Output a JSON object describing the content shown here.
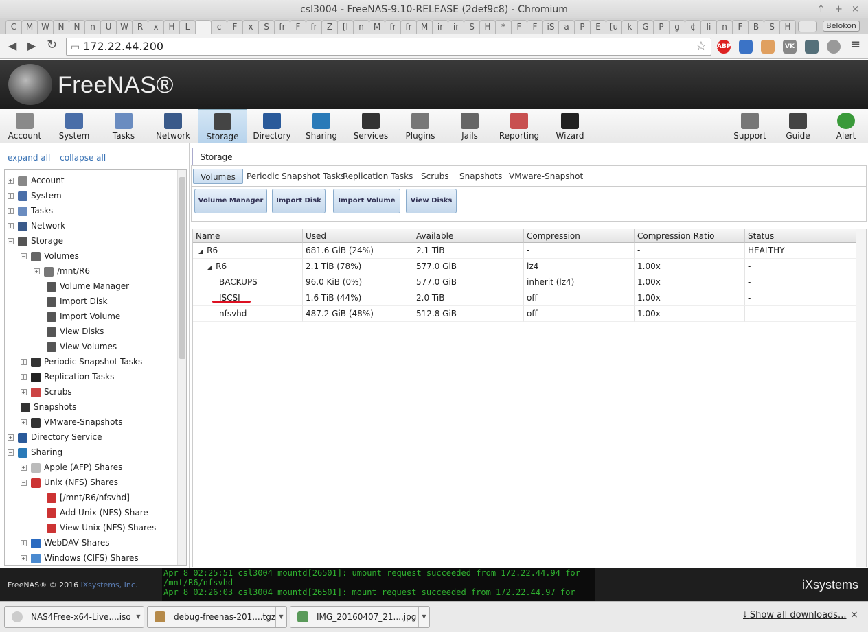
{
  "window": {
    "title": "csl3004 - FreeNAS-9.10-RELEASE (2def9c8) - Chromium"
  },
  "tabs": [
    "C",
    "M",
    "W",
    "N",
    "N",
    "n",
    "U",
    "W",
    "R",
    "x",
    "H",
    "L",
    "",
    "c",
    "F",
    "x",
    "S",
    "fr",
    "F",
    "fr",
    "Z",
    "[I",
    "n",
    "M",
    "fr",
    "fr",
    "M",
    "ir",
    "ir",
    "S",
    "H",
    "*",
    "F",
    "F",
    "iS",
    "a",
    "P",
    "E",
    "[u",
    "k",
    "G",
    "P",
    "g",
    "¢",
    "li",
    "n",
    "F",
    "B",
    "S",
    "H"
  ],
  "browser": {
    "user": "Belokon",
    "url": "172.22.44.200",
    "extensions": [
      "ABP",
      "",
      "",
      "VK",
      "",
      ""
    ]
  },
  "brand": "FreeNAS®",
  "topnav": [
    "Account",
    "System",
    "Tasks",
    "Network",
    "Storage",
    "Directory",
    "Sharing",
    "Services",
    "Plugins",
    "Jails",
    "Reporting",
    "Wizard",
    "Support",
    "Guide",
    "Alert"
  ],
  "left": {
    "expand_all": "expand all",
    "collapse_all": "collapse all"
  },
  "tree": [
    {
      "label": "Account",
      "level": 0,
      "toggle": "+"
    },
    {
      "label": "System",
      "level": 0,
      "toggle": "+"
    },
    {
      "label": "Tasks",
      "level": 0,
      "toggle": "+"
    },
    {
      "label": "Network",
      "level": 0,
      "toggle": "+"
    },
    {
      "label": "Storage",
      "level": 0,
      "toggle": "−"
    },
    {
      "label": "Volumes",
      "level": 1,
      "toggle": "−"
    },
    {
      "label": "/mnt/R6",
      "level": 2,
      "toggle": "+"
    },
    {
      "label": "Volume Manager",
      "level": 3,
      "toggle": ""
    },
    {
      "label": "Import Disk",
      "level": 3,
      "toggle": ""
    },
    {
      "label": "Import Volume",
      "level": 3,
      "toggle": ""
    },
    {
      "label": "View Disks",
      "level": 3,
      "toggle": ""
    },
    {
      "label": "View Volumes",
      "level": 3,
      "toggle": ""
    },
    {
      "label": "Periodic Snapshot Tasks",
      "level": 1,
      "toggle": "+"
    },
    {
      "label": "Replication Tasks",
      "level": 1,
      "toggle": "+"
    },
    {
      "label": "Scrubs",
      "level": 1,
      "toggle": "+"
    },
    {
      "label": "Snapshots",
      "level": 1,
      "toggle": ""
    },
    {
      "label": "VMware-Snapshots",
      "level": 1,
      "toggle": "+"
    },
    {
      "label": "Directory Service",
      "level": 0,
      "toggle": "+"
    },
    {
      "label": "Sharing",
      "level": 0,
      "toggle": "−"
    },
    {
      "label": "Apple (AFP) Shares",
      "level": 1,
      "toggle": "+"
    },
    {
      "label": "Unix (NFS) Shares",
      "level": 1,
      "toggle": "−"
    },
    {
      "label": "[/mnt/R6/nfsvhd]",
      "level": 3,
      "toggle": ""
    },
    {
      "label": "Add Unix (NFS) Share",
      "level": 3,
      "toggle": ""
    },
    {
      "label": "View Unix (NFS) Shares",
      "level": 3,
      "toggle": ""
    },
    {
      "label": "WebDAV Shares",
      "level": 1,
      "toggle": "+"
    },
    {
      "label": "Windows (CIFS) Shares",
      "level": 1,
      "toggle": "+"
    }
  ],
  "storage": {
    "tab": "Storage",
    "subtabs": [
      "Volumes",
      "Periodic Snapshot Tasks",
      "Replication Tasks",
      "Scrubs",
      "Snapshots",
      "VMware-Snapshot"
    ],
    "actions": [
      "Volume Manager",
      "Import Disk",
      "Import Volume",
      "View Disks"
    ],
    "columns": [
      "Name",
      "Used",
      "Available",
      "Compression",
      "Compression Ratio",
      "Status"
    ],
    "rows": [
      {
        "name": "R6",
        "tri": "◢",
        "indent": 0,
        "used": "681.6 GiB (24%)",
        "available": "2.1 TiB",
        "compression": "-",
        "ratio": "-",
        "status": "HEALTHY"
      },
      {
        "name": "R6",
        "tri": "◢",
        "indent": 1,
        "used": "2.1 TiB (78%)",
        "available": "577.0 GiB",
        "compression": "lz4",
        "ratio": "1.00x",
        "status": "-"
      },
      {
        "name": "BACKUPS",
        "tri": "",
        "indent": 2,
        "used": "96.0 KiB (0%)",
        "available": "577.0 GiB",
        "compression": "inherit (lz4)",
        "ratio": "1.00x",
        "status": "-"
      },
      {
        "name": "ISCSI",
        "tri": "",
        "indent": 2,
        "used": "1.6 TiB (44%)",
        "available": "2.0 TiB",
        "compression": "off",
        "ratio": "1.00x",
        "status": "-"
      },
      {
        "name": "nfsvhd",
        "tri": "",
        "indent": 2,
        "used": "487.2 GiB (48%)",
        "available": "512.8 GiB",
        "compression": "off",
        "ratio": "1.00x",
        "status": "-"
      }
    ]
  },
  "footer": {
    "copyright": "FreeNAS® © 2016",
    "company": "iXsystems, Inc.",
    "console": [
      "Apr  8 02:25:51 csl3004 mountd[26501]: umount request succeeded from 172.22.44.94 for",
      "/mnt/R6/nfsvhd",
      "Apr  8 02:26:03 csl3004 mountd[26501]: mount request succeeded from 172.22.44.97 for"
    ],
    "logo": "iXsystems"
  },
  "downloads": {
    "items": [
      "NAS4Free-x64-Live....iso",
      "debug-freenas-201....tgz",
      "IMG_20160407_21....jpg"
    ],
    "show_all": "Show all downloads...",
    "close": "×"
  },
  "colors": {
    "accent": "#3a73b5",
    "console_text": "#2fb02f",
    "red_mark": "#dd1122",
    "active_tab": "#b7d3ec"
  }
}
